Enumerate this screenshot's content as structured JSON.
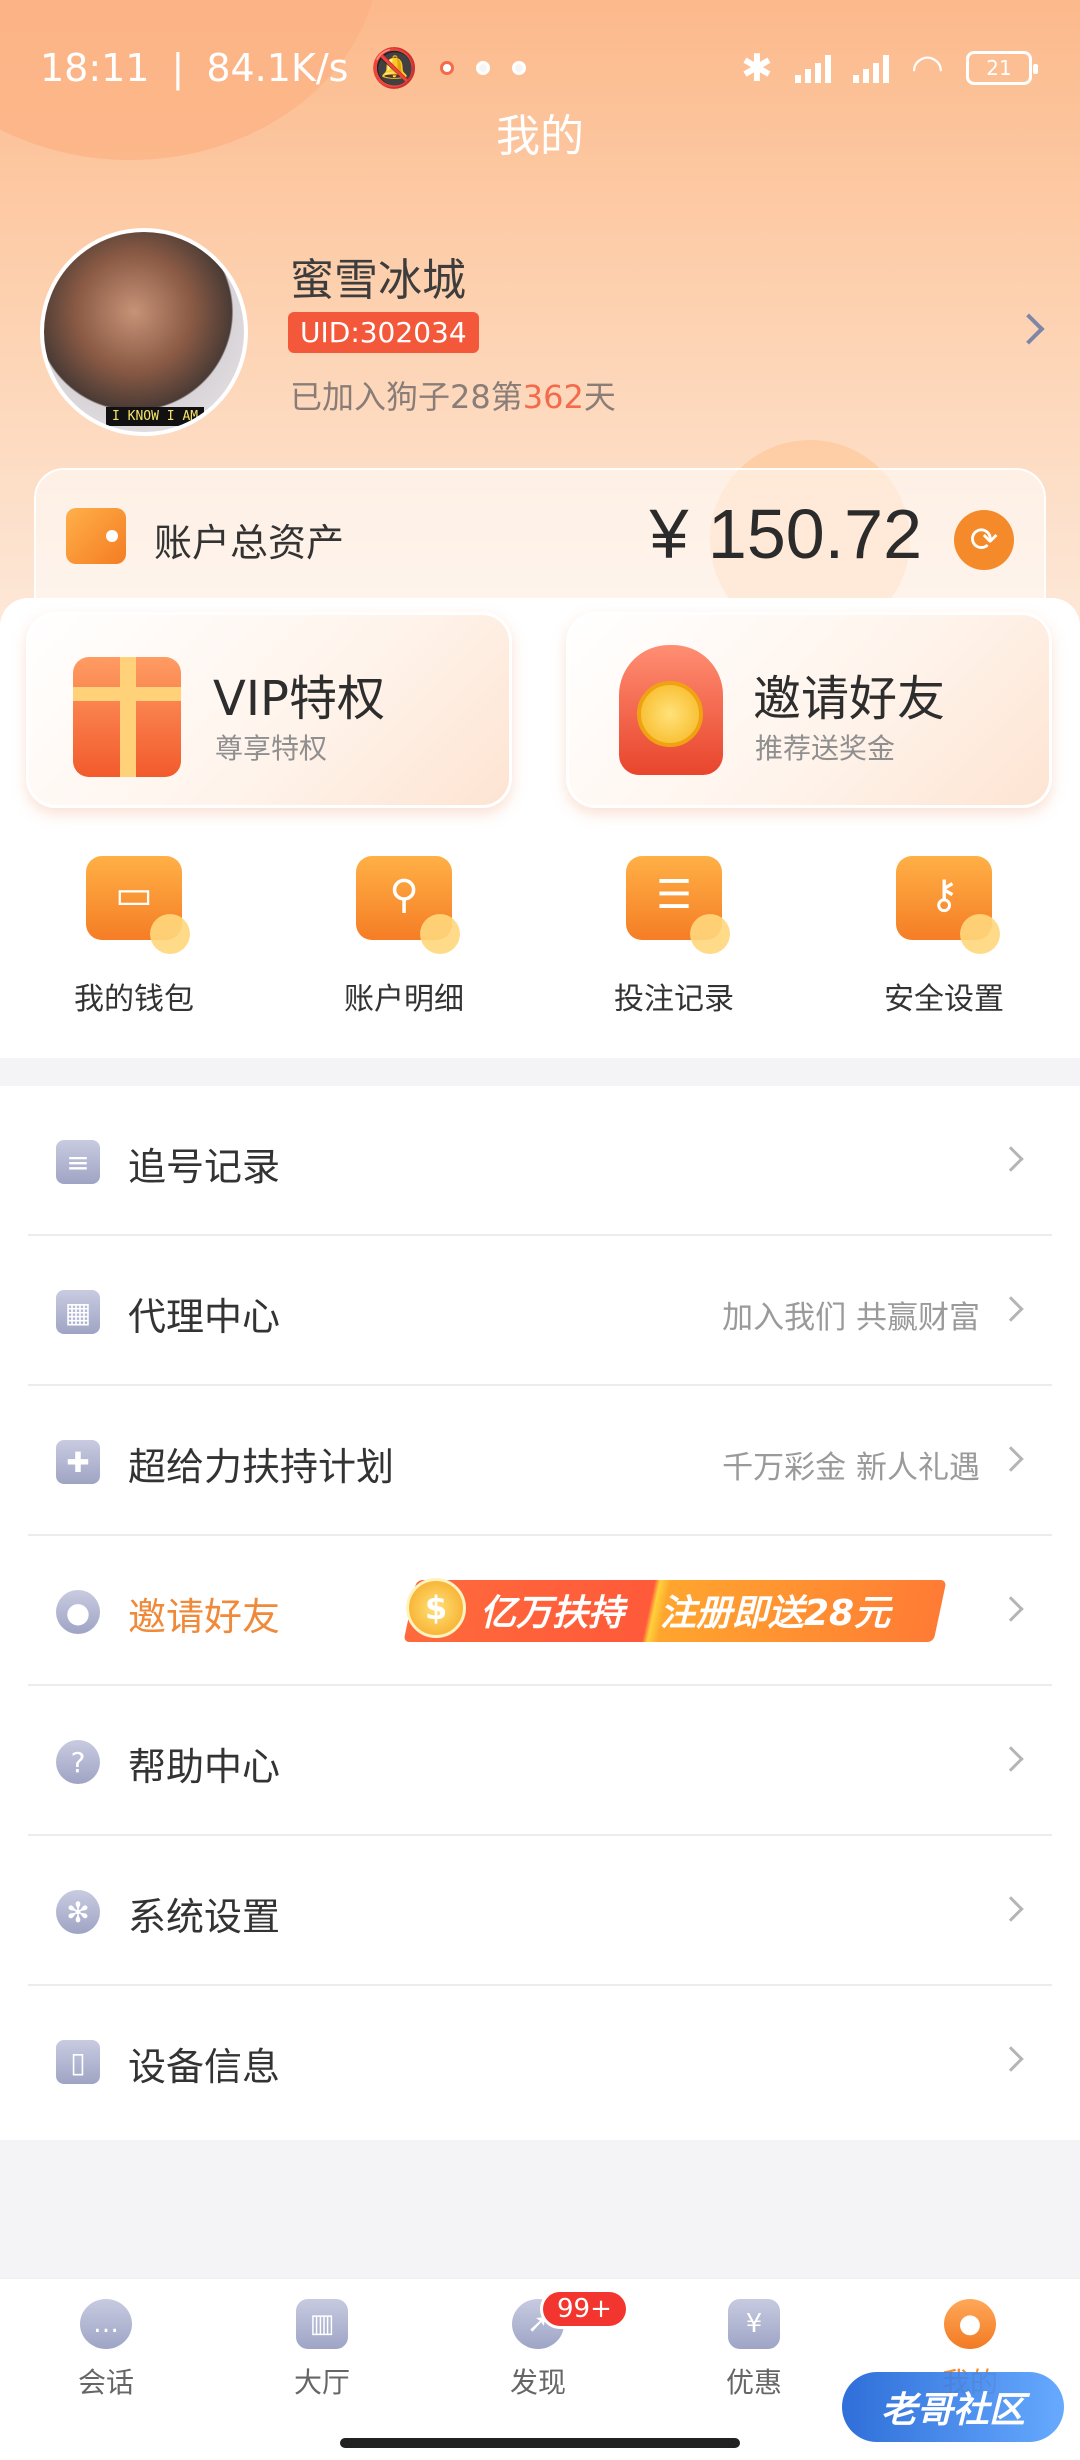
{
  "status_bar": {
    "time": "18:11",
    "net_speed": "84.1K/s",
    "battery": "21"
  },
  "page_title": "我的",
  "profile": {
    "username": "蜜雪冰城",
    "uid": "UID:302034",
    "avatar_caption": "I KNOW I AM",
    "join_prefix": "已加入狗子28第",
    "join_days": "362",
    "join_suffix": "天"
  },
  "assets": {
    "label": "账户总资产",
    "amount": "¥ 150.72"
  },
  "promo": {
    "vip": {
      "title": "VIP特权",
      "subtitle": "尊享特权"
    },
    "invite": {
      "title": "邀请好友",
      "subtitle": "推荐送奖金"
    }
  },
  "quick_actions": [
    {
      "label": "我的钱包",
      "icon": "wallet-icon"
    },
    {
      "label": "账户明细",
      "icon": "search-icon"
    },
    {
      "label": "投注记录",
      "icon": "clipboard-icon"
    },
    {
      "label": "安全设置",
      "icon": "key-icon"
    }
  ],
  "menu": [
    {
      "label": "追号记录",
      "hint": "",
      "icon": "document-icon"
    },
    {
      "label": "代理中心",
      "hint": "加入我们 共赢财富",
      "icon": "qrcode-icon"
    },
    {
      "label": "超给力扶持计划",
      "hint": "千万彩金 新人礼遇",
      "icon": "gift-icon"
    },
    {
      "label": "邀请好友",
      "hint": "",
      "icon": "user-icon",
      "banner_left": "亿万扶持",
      "banner_right": "注册即送28元"
    },
    {
      "label": "帮助中心",
      "hint": "",
      "icon": "help-icon"
    },
    {
      "label": "系统设置",
      "hint": "",
      "icon": "gear-icon"
    },
    {
      "label": "设备信息",
      "hint": "",
      "icon": "tablet-icon"
    }
  ],
  "tabs": [
    {
      "label": "会话",
      "icon": "chat-icon"
    },
    {
      "label": "大厅",
      "icon": "bank-icon"
    },
    {
      "label": "发现",
      "icon": "compass-icon",
      "badge": "99+"
    },
    {
      "label": "优惠",
      "icon": "ticket-icon"
    },
    {
      "label": "我的",
      "icon": "profile-icon",
      "active": true
    }
  ],
  "watermark": "老哥社区",
  "colors": {
    "accent": "#f58a2b",
    "highlight": "#f46b4b",
    "badge": "#f2352e"
  }
}
